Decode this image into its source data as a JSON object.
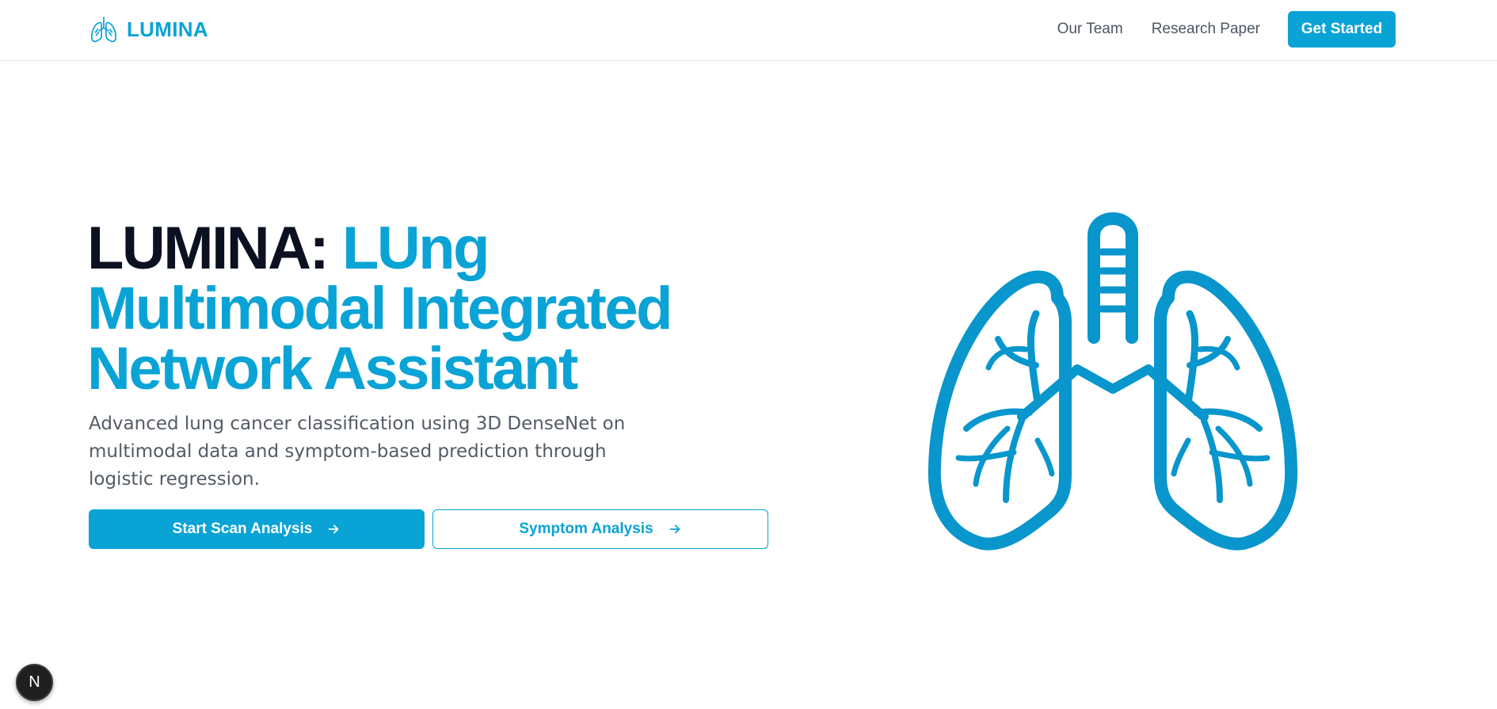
{
  "header": {
    "brand_name": "LUMINA",
    "brand_icon": "lungs-icon",
    "nav": [
      {
        "label": "Our Team"
      },
      {
        "label": "Research Paper"
      }
    ],
    "cta_label": "Get Started"
  },
  "hero": {
    "title_prefix": "LUMINA:",
    "title_line1_accent": "LUng",
    "title_line2": "Multimodal Integrated",
    "title_line3": "Network Assistant",
    "description": "Advanced lung cancer classification using 3D DenseNet on multimodal data and symptom-based prediction through logistic regression.",
    "primary_button": "Start Scan Analysis",
    "secondary_button": "Symptom Analysis",
    "illustration": "lungs-illustration"
  },
  "dev_badge": {
    "label": "N",
    "icon": "nextjs-icon"
  },
  "colors": {
    "accent": "#0aa3d6",
    "heading_dark": "#0b1120",
    "body_text": "#545b66",
    "nav_text": "#4b5563"
  }
}
